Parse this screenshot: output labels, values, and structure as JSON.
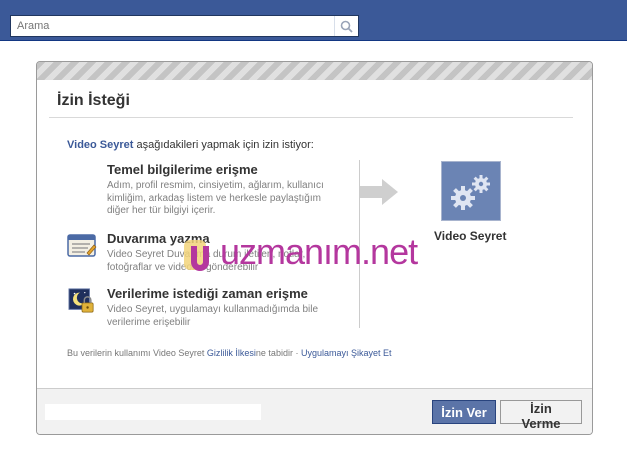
{
  "search": {
    "placeholder": "Arama"
  },
  "dialog": {
    "title": "İzin İsteği",
    "intro_app": "Video Seyret",
    "intro_text": " aşağıdakileri yapmak için izin istiyor:",
    "permissions": [
      {
        "icon": "person-icon",
        "title": "Temel bilgilerime erişme",
        "description": "Adım, profil resmim, cinsiyetim, ağlarım, kullanıcı kimliğim, arkadaş listem ve herkesle paylaştığım diğer her tür bilgiyi içerir."
      },
      {
        "icon": "wall-post-icon",
        "title": "Duvarıma yazma",
        "description": "Video Seyret Duvarıma durum iletileri, notlar, fotoğraflar ve videolar gönderebilir"
      },
      {
        "icon": "night-lock-icon",
        "title": "Verilerime istediği zaman erişme",
        "description": "Video Seyret, uygulamayı kullanmadığımda bile verilerime erişebilir"
      }
    ],
    "app_name": "Video Seyret",
    "footer": {
      "prefix": "Bu verilerin kullanımı Video Seyret ",
      "privacy_link": "Gizlilik İlkesi",
      "middle": "ne tabidir · ",
      "report_link": "Uygulamayı Şikayet Et"
    },
    "buttons": {
      "allow": "İzin Ver",
      "deny": "İzin Verme"
    }
  },
  "watermark": {
    "text": "uzmanım.net"
  },
  "colors": {
    "brand": "#3b5998",
    "watermark": "#b4379e",
    "link": "#3b5998"
  }
}
